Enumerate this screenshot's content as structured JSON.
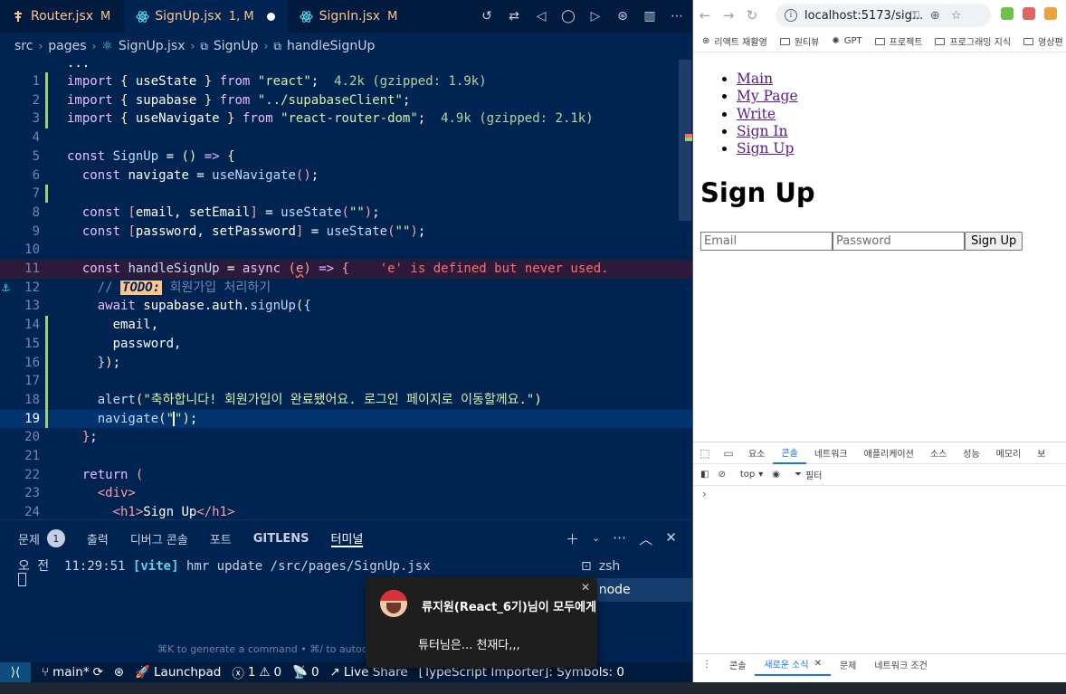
{
  "vscode": {
    "tabs": [
      {
        "name": "Router.jsx",
        "badge": "M",
        "active": false
      },
      {
        "name": "SignUp.jsx",
        "badge": "1, M",
        "active": true
      },
      {
        "name": "SignIn.jsx",
        "badge": "M",
        "active": false
      }
    ],
    "breadcrumb": [
      "src",
      "pages",
      "SignUp.jsx",
      "SignUp",
      "handleSignUp"
    ],
    "editor_ellipsis": "...",
    "lines": [
      {
        "n": "1"
      },
      {
        "n": "2"
      },
      {
        "n": "3"
      },
      {
        "n": "4"
      },
      {
        "n": "5"
      },
      {
        "n": "6"
      },
      {
        "n": "7"
      },
      {
        "n": "8"
      },
      {
        "n": "9"
      },
      {
        "n": "10"
      },
      {
        "n": "11"
      },
      {
        "n": "12"
      },
      {
        "n": "13"
      },
      {
        "n": "14"
      },
      {
        "n": "15"
      },
      {
        "n": "16"
      },
      {
        "n": "17"
      },
      {
        "n": "18"
      },
      {
        "n": "19"
      },
      {
        "n": "20"
      },
      {
        "n": "21"
      },
      {
        "n": "22"
      },
      {
        "n": "23"
      },
      {
        "n": "24"
      }
    ],
    "code": {
      "l1_hint": "4.2k (gzipped: 1.9k)",
      "l3_hint": "4.9k (gzipped: 2.1k)",
      "l11_error": "'e' is defined but never used.",
      "l12_todo": "TODO:",
      "l12_comment": "회원가입 처리하기",
      "l18_alert": "\"축하합니다! 회원가입이 완료됐어요. 로그인 페이지로 이동할께요.\""
    },
    "panel": {
      "tabs": [
        "문제",
        "출력",
        "디버그 콘솔",
        "포트",
        "GITLENS",
        "터미널"
      ],
      "problems_count": "1",
      "terminal_time": "오 전  11:29:51",
      "terminal_vite": "[vite]",
      "terminal_msg": "hmr update /src/pages/SignUp.jsx",
      "terminals": [
        "zsh",
        "node"
      ],
      "hint": "⌘K to generate a command • ⌘/ to autoc"
    },
    "statusbar": {
      "branch": "main*",
      "launchpad": "Launchpad",
      "errors": "1",
      "warnings": "0",
      "ports": "0",
      "liveshare": "Live Share",
      "ts": "[TypeScript Importer]: Symbols: 0"
    }
  },
  "toast": {
    "sender": "류지원(React_6기)님이 모두에게",
    "message": "튜터님은... 천재다,,,"
  },
  "browser": {
    "url": "localhost:5173/sig...",
    "bookmarks": [
      "리액트 재활영",
      "원티뷰",
      "GPT",
      "프로젝트",
      "프로그래밍 지식",
      "영상편"
    ],
    "nav": [
      "Main",
      "My Page",
      "Write",
      "Sign In",
      "Sign Up"
    ],
    "title": "Sign Up",
    "email_placeholder": "Email",
    "password_placeholder": "Password",
    "submit_label": "Sign Up",
    "devtools": {
      "tabs": [
        "요소",
        "콘솔",
        "네트워크",
        "애플리케이션",
        "소스",
        "성능",
        "메모리",
        "보"
      ],
      "active_tab": "콘솔",
      "context": "top",
      "filter": "필터",
      "drawer_tabs": [
        "콘솔",
        "새로운 소식",
        "문제",
        "네트워크 조건"
      ]
    }
  },
  "colors": {
    "editor_bg": "#002451",
    "accent_warning": "#ffc58f",
    "error": "#ff6b6b"
  }
}
